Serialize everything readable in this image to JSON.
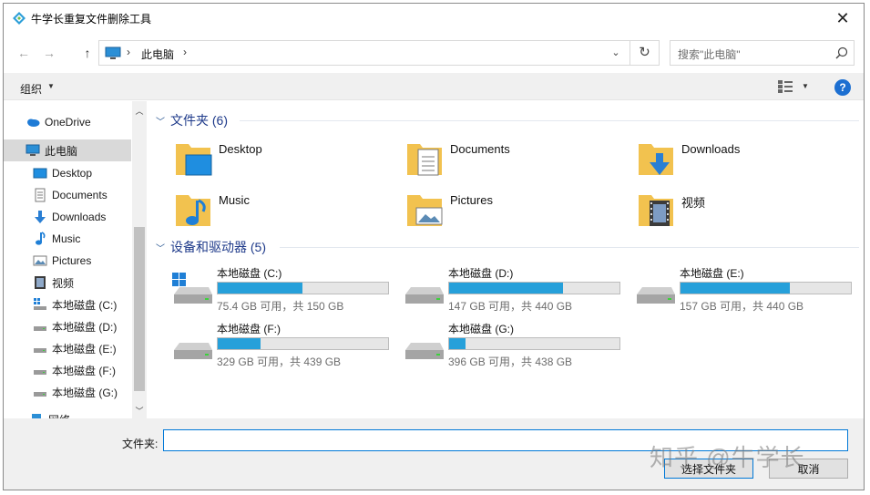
{
  "window": {
    "title": "牛学长重复文件删除工具"
  },
  "address": {
    "location": "此电脑",
    "search_placeholder": "搜索\"此电脑\""
  },
  "toolbar": {
    "organize_label": "组织",
    "help_label": "?"
  },
  "sidebar": {
    "items": [
      {
        "label": "OneDrive",
        "icon": "onedrive-icon"
      },
      {
        "label": "此电脑",
        "icon": "computer-icon"
      },
      {
        "label": "Desktop",
        "icon": "desktop-icon"
      },
      {
        "label": "Documents",
        "icon": "documents-icon"
      },
      {
        "label": "Downloads",
        "icon": "downloads-icon"
      },
      {
        "label": "Music",
        "icon": "music-icon"
      },
      {
        "label": "Pictures",
        "icon": "pictures-icon"
      },
      {
        "label": "视频",
        "icon": "video-icon"
      },
      {
        "label": "本地磁盘 (C:)",
        "icon": "drive-icon"
      },
      {
        "label": "本地磁盘 (D:)",
        "icon": "drive-icon"
      },
      {
        "label": "本地磁盘 (E:)",
        "icon": "drive-icon"
      },
      {
        "label": "本地磁盘 (F:)",
        "icon": "drive-icon"
      },
      {
        "label": "本地磁盘 (G:)",
        "icon": "drive-icon"
      },
      {
        "label": "网络",
        "icon": "network-icon"
      }
    ]
  },
  "folders_group": {
    "title": "文件夹 (6)",
    "items": [
      {
        "label": "Desktop"
      },
      {
        "label": "Documents"
      },
      {
        "label": "Downloads"
      },
      {
        "label": "Music"
      },
      {
        "label": "Pictures"
      },
      {
        "label": "视频"
      }
    ]
  },
  "drives_group": {
    "title": "设备和驱动器 (5)",
    "items": [
      {
        "name": "本地磁盘 (C:)",
        "free": "75.4 GB 可用，共 150 GB",
        "used_fraction": 0.497
      },
      {
        "name": "本地磁盘 (D:)",
        "free": "147 GB 可用，共 440 GB",
        "used_fraction": 0.666
      },
      {
        "name": "本地磁盘 (E:)",
        "free": "157 GB 可用，共 440 GB",
        "used_fraction": 0.643
      },
      {
        "name": "本地磁盘 (F:)",
        "free": "329 GB 可用，共 439 GB",
        "used_fraction": 0.251
      },
      {
        "name": "本地磁盘 (G:)",
        "free": "396 GB 可用，共 438 GB",
        "used_fraction": 0.096
      }
    ]
  },
  "bottom": {
    "folder_label": "文件夹:",
    "folder_value": "",
    "select_button": "选择文件夹",
    "cancel_button": "取消"
  },
  "watermark": "知乎 @牛学长",
  "colors": {
    "accent": "#0078d7",
    "drive_bar": "#26a0da",
    "group_title": "#1e3a8a"
  }
}
